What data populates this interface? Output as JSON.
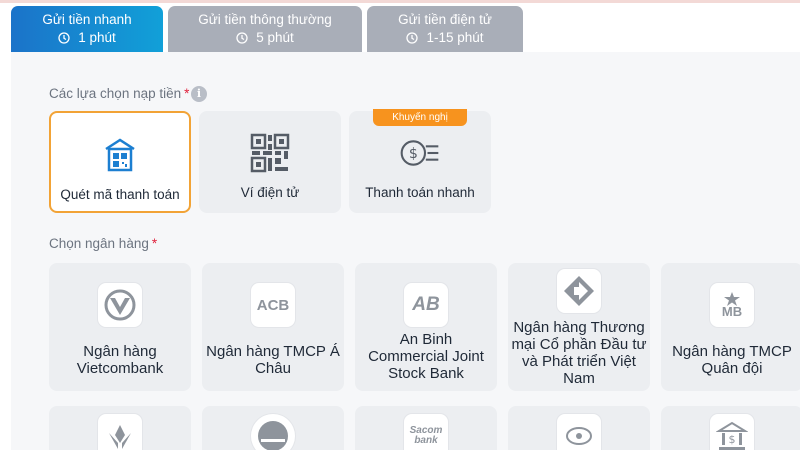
{
  "tabs": [
    {
      "title": "Gửi tiền nhanh",
      "time": "1 phút"
    },
    {
      "title": "Gửi tiền thông thường",
      "time": "5 phút"
    },
    {
      "title": "Gửi tiền điện tử",
      "time": "1-15 phút"
    }
  ],
  "deposit_options": {
    "label": "Các lựa chọn nạp tiền",
    "required_mark": "*",
    "items": [
      {
        "label": "Quét mã thanh toán",
        "icon": "qr-scan-icon"
      },
      {
        "label": "Ví điện tử",
        "icon": "qr-code-icon"
      },
      {
        "label": "Thanh toán nhanh",
        "icon": "fast-payment-icon",
        "badge": "Khuyến nghị"
      }
    ]
  },
  "banks": {
    "label": "Chọn ngân hàng",
    "required_mark": "*",
    "items": [
      {
        "name": "Ngân hàng Vietcombank"
      },
      {
        "name": "Ngân hàng TMCP Á Châu",
        "logo_text": "ACB"
      },
      {
        "name": "An Binh Commercial Joint Stock Bank",
        "logo_text": "AB"
      },
      {
        "name": "Ngân hàng Thương mại Cổ phần Đầu tư và Phát triển Việt Nam"
      },
      {
        "name": "Ngân hàng TMCP Quân đội",
        "logo_text": "MB"
      }
    ],
    "logo_texts_row2": {
      "sacom_1": "Sacom",
      "sacom_2": "bank"
    }
  },
  "colors": {
    "active_tab": "#1b73c9",
    "inactive_tab": "#a9aeb8",
    "selected_border": "#f2a336",
    "badge": "#f7931e",
    "required": "#e0213c"
  }
}
